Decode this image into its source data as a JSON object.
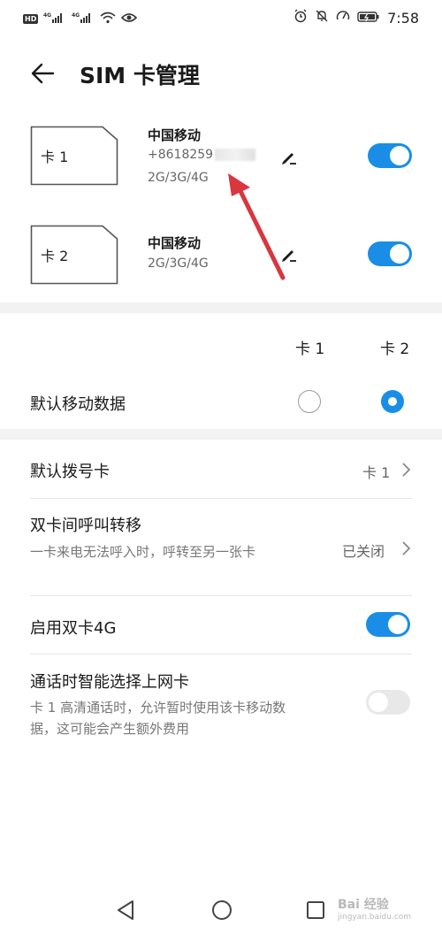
{
  "status": {
    "left_badge": "HD",
    "sig1": "4G",
    "sig2": "4G",
    "time": "7:58"
  },
  "header": {
    "title": "SIM 卡管理"
  },
  "sims": [
    {
      "label": "卡 1",
      "carrier": "中国移动",
      "number_prefix": "+8618259",
      "network": "2G/3G/4G",
      "enabled": true
    },
    {
      "label": "卡 2",
      "carrier": "中国移动",
      "network": "2G/3G/4G",
      "enabled": true
    }
  ],
  "default_data": {
    "col1": "卡 1",
    "col2": "卡 2",
    "title": "默认移动数据",
    "selected": "卡 2"
  },
  "settings": {
    "dial_card": {
      "title": "默认拨号卡",
      "value": "卡 1"
    },
    "forward": {
      "title": "双卡间呼叫转移",
      "sub": "一卡来电无法呼入时，呼转至另一张卡",
      "value": "已关闭"
    },
    "dual4g": {
      "title": "启用双卡4G",
      "enabled": true
    },
    "smart": {
      "title": "通话时智能选择上网卡",
      "sub": "卡 1 高清通话时，允许暂时使用该卡移动数据，这可能会产生额外费用",
      "enabled": false
    }
  },
  "watermark": {
    "main": "Bai 经验",
    "sub": "jingyan.baidu.com"
  },
  "colors": {
    "accent": "#1a8ee6",
    "arrow": "#d9363e"
  }
}
